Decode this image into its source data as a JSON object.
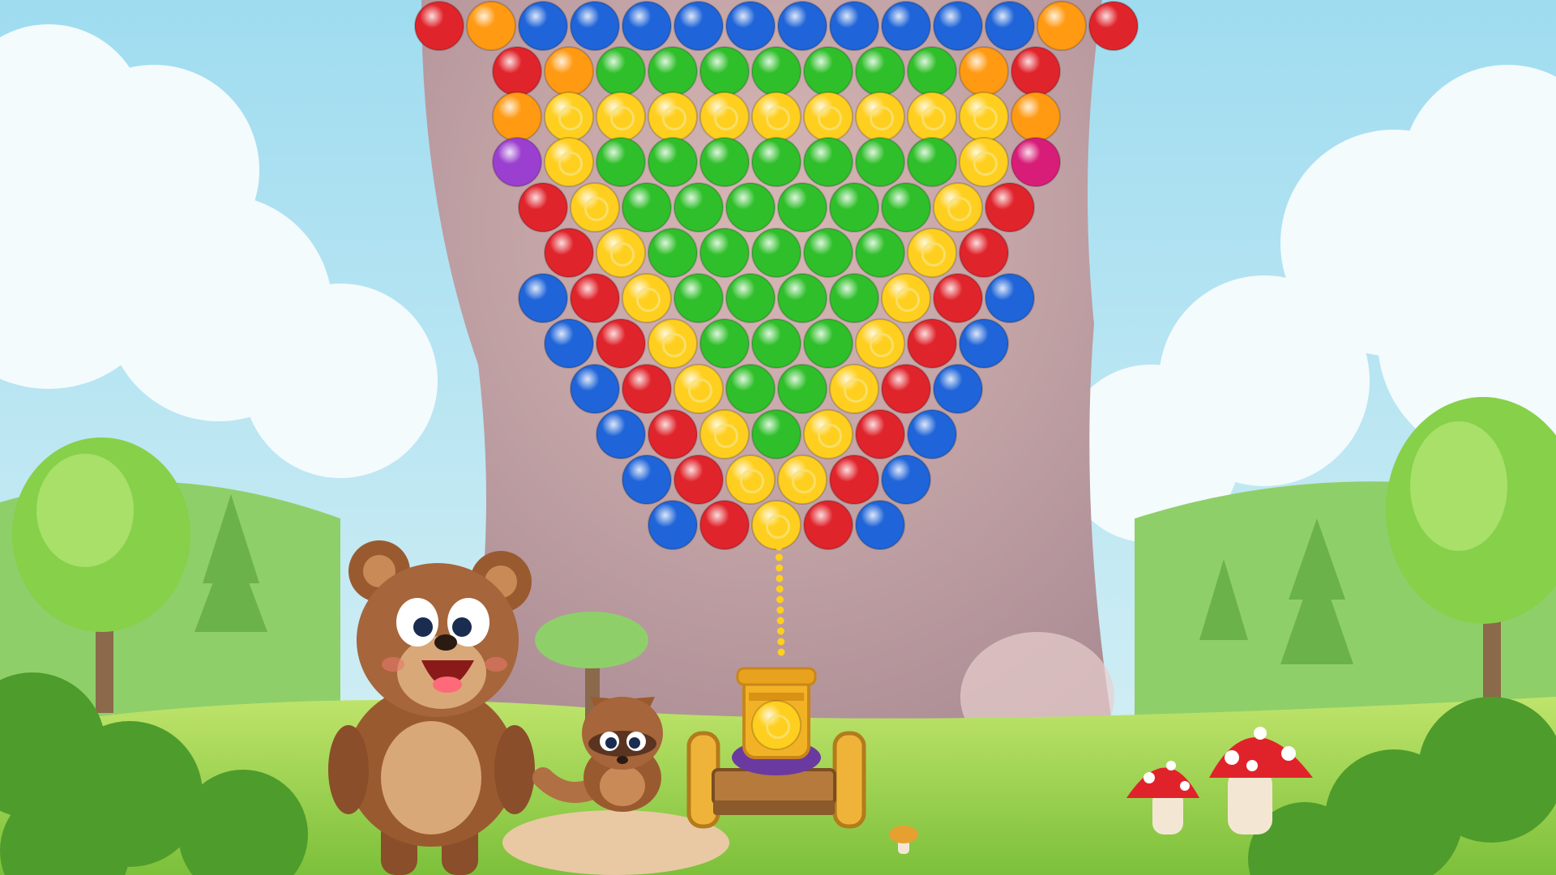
{
  "game": {
    "genre": "bubble-shooter",
    "shooter_bubble_color": "yellow"
  },
  "palette": {
    "red": "#e0242b",
    "orange": "#ff9a12",
    "yellow": "#ffcf1f",
    "green": "#2fbf2a",
    "blue": "#1f64d8",
    "purple": "#9b3fd0",
    "magenta": "#d81d78",
    "sky": "#bfe6f2",
    "grass": "#9fd64a",
    "tree_trunk": "#c2a1a6"
  },
  "bubble_rows": [
    [
      "red",
      "orange",
      "blue",
      "blue",
      "blue",
      "blue",
      "blue",
      "blue",
      "blue",
      "blue",
      "blue",
      "blue",
      "orange",
      "red"
    ],
    [
      "red",
      "orange",
      "green",
      "green",
      "green",
      "green",
      "green",
      "green",
      "green",
      "orange",
      "red"
    ],
    [
      "orange",
      "yellow",
      "yellow",
      "yellow",
      "yellow",
      "yellow",
      "yellow",
      "yellow",
      "yellow",
      "yellow",
      "orange"
    ],
    [
      "purple",
      "yellow",
      "green",
      "green",
      "green",
      "green",
      "green",
      "green",
      "green",
      "yellow",
      "magenta"
    ],
    [
      "red",
      "yellow",
      "green",
      "green",
      "green",
      "green",
      "green",
      "green",
      "yellow",
      "red"
    ],
    [
      "red",
      "yellow",
      "green",
      "green",
      "green",
      "green",
      "green",
      "yellow",
      "red"
    ],
    [
      "blue",
      "red",
      "yellow",
      "green",
      "green",
      "green",
      "green",
      "yellow",
      "red",
      "blue"
    ],
    [
      "blue",
      "red",
      "yellow",
      "green",
      "green",
      "green",
      "yellow",
      "red",
      "blue"
    ],
    [
      "blue",
      "red",
      "yellow",
      "green",
      "green",
      "yellow",
      "red",
      "blue"
    ],
    [
      "blue",
      "red",
      "yellow",
      "green",
      "yellow",
      "red",
      "blue"
    ],
    [
      "blue",
      "red",
      "yellow",
      "yellow",
      "red",
      "blue"
    ],
    [
      "blue",
      "red",
      "yellow",
      "red",
      "blue"
    ]
  ],
  "characters": [
    "bear-character",
    "raccoon-character"
  ],
  "decorations": [
    "mushroom-small",
    "mushroom-large"
  ]
}
